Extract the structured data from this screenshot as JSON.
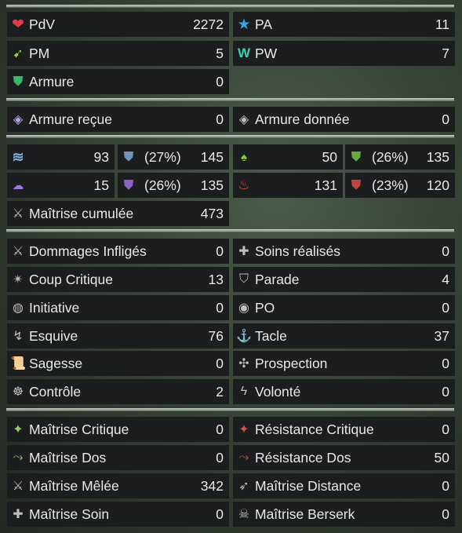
{
  "vitals": {
    "pdv": {
      "label": "PdV",
      "value": "2272"
    },
    "pa": {
      "label": "PA",
      "value": "11"
    },
    "pm": {
      "label": "PM",
      "value": "5"
    },
    "pw": {
      "label": "PW",
      "value": "7"
    },
    "armure": {
      "label": "Armure",
      "value": "0"
    }
  },
  "armor_exchange": {
    "received": {
      "label": "Armure reçue",
      "value": "0"
    },
    "given": {
      "label": "Armure donnée",
      "value": "0"
    }
  },
  "elements": {
    "water": {
      "mastery": "93",
      "resist_pct": "(27%)",
      "resist": "145"
    },
    "earth": {
      "mastery": "50",
      "resist_pct": "(26%)",
      "resist": "135"
    },
    "air": {
      "mastery": "15",
      "resist_pct": "(26%)",
      "resist": "135"
    },
    "fire": {
      "mastery": "131",
      "resist_pct": "(23%)",
      "resist": "120"
    },
    "cumulated": {
      "label": "Maîtrise cumulée",
      "value": "473"
    }
  },
  "secondary": [
    {
      "label": "Dommages Infligés",
      "value": "0",
      "icon": "sword-icon"
    },
    {
      "label": "Soins réalisés",
      "value": "0",
      "icon": "heal-icon"
    },
    {
      "label": "Coup Critique",
      "value": "13",
      "icon": "critical-icon"
    },
    {
      "label": "Parade",
      "value": "4",
      "icon": "parry-icon"
    },
    {
      "label": "Initiative",
      "value": "0",
      "icon": "initiative-icon"
    },
    {
      "label": "PO",
      "value": "0",
      "icon": "range-icon"
    },
    {
      "label": "Esquive",
      "value": "76",
      "icon": "dodge-icon"
    },
    {
      "label": "Tacle",
      "value": "37",
      "icon": "lock-icon"
    },
    {
      "label": "Sagesse",
      "value": "0",
      "icon": "wisdom-icon"
    },
    {
      "label": "Prospection",
      "value": "0",
      "icon": "prospecting-icon"
    },
    {
      "label": "Contrôle",
      "value": "2",
      "icon": "control-icon"
    },
    {
      "label": "Volonté",
      "value": "0",
      "icon": "willpower-icon"
    }
  ],
  "masteries": [
    {
      "label": "Maîtrise Critique",
      "value": "0",
      "icon": "critical-mastery-icon"
    },
    {
      "label": "Résistance Critique",
      "value": "0",
      "icon": "critical-resistance-icon"
    },
    {
      "label": "Maîtrise Dos",
      "value": "0",
      "icon": "rear-mastery-icon"
    },
    {
      "label": "Résistance Dos",
      "value": "50",
      "icon": "rear-resistance-icon"
    },
    {
      "label": "Maîtrise Mêlée",
      "value": "342",
      "icon": "melee-mastery-icon"
    },
    {
      "label": "Maîtrise Distance",
      "value": "0",
      "icon": "distance-mastery-icon"
    },
    {
      "label": "Maîtrise Soin",
      "value": "0",
      "icon": "healing-mastery-icon"
    },
    {
      "label": "Maîtrise Berserk",
      "value": "0",
      "icon": "berserk-mastery-icon"
    }
  ]
}
